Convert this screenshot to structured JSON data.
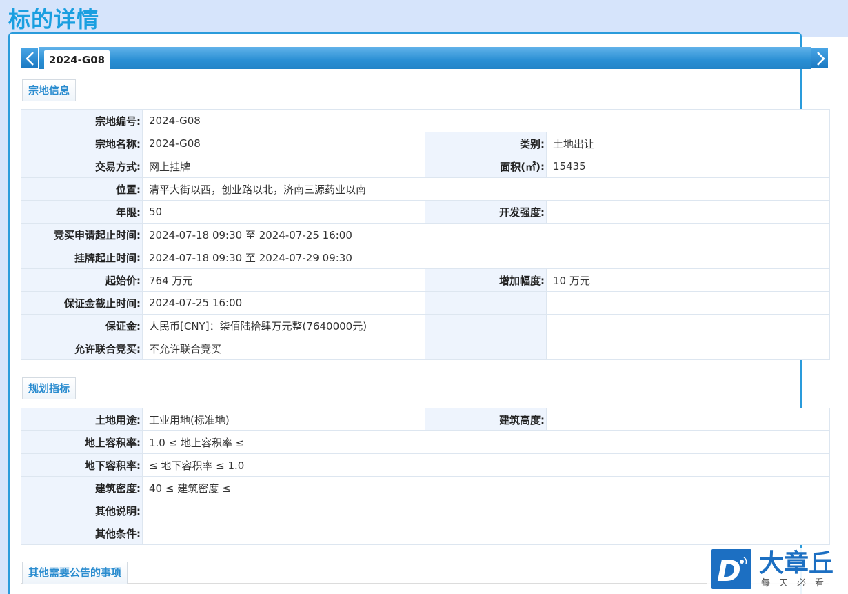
{
  "page": {
    "title": "标的详情"
  },
  "tab": {
    "active_label": "2024-G08"
  },
  "sections": {
    "land_info": "宗地信息",
    "planning": "规划指标",
    "other_notices": "其他需要公告的事项"
  },
  "land_info": {
    "parcel_number": {
      "label": "宗地编号:",
      "value": "2024-G08"
    },
    "parcel_name": {
      "label": "宗地名称:",
      "value": "2024-G08"
    },
    "category": {
      "label": "类别:",
      "value": "土地出让"
    },
    "trade_method": {
      "label": "交易方式:",
      "value": "网上挂牌"
    },
    "area": {
      "label": "面积(㎡):",
      "value": "15435"
    },
    "location": {
      "label": "位置:",
      "value": "清平大街以西，创业路以北，济南三源药业以南"
    },
    "term": {
      "label": "年限:",
      "value": "50"
    },
    "dev_intensity": {
      "label": "开发强度:",
      "value": ""
    },
    "bid_apply_period": {
      "label": "竞买申请起止时间:",
      "value": "2024-07-18 09:30 至 2024-07-25 16:00"
    },
    "listing_period": {
      "label": "挂牌起止时间:",
      "value": "2024-07-18 09:30 至 2024-07-29 09:30"
    },
    "starting_price": {
      "label": "起始价:",
      "value": "764 万元"
    },
    "increment": {
      "label": "增加幅度:",
      "value": "10 万元"
    },
    "deposit_deadline": {
      "label": "保证金截止时间:",
      "value": "2024-07-25 16:00"
    },
    "deposit": {
      "label": "保证金:",
      "value": "人民币[CNY]：柒佰陆拾肆万元整(7640000元)"
    },
    "joint_bid": {
      "label": "允许联合竞买:",
      "value": "不允许联合竞买"
    }
  },
  "planning": {
    "land_use": {
      "label": "土地用途:",
      "value": "工业用地(标准地)"
    },
    "building_height": {
      "label": "建筑高度:",
      "value": ""
    },
    "far_above": {
      "label": "地上容积率:",
      "value": "1.0 ≤ 地上容积率 ≤"
    },
    "far_below": {
      "label": "地下容积率:",
      "value": "≤ 地下容积率 ≤ 1.0"
    },
    "building_density": {
      "label": "建筑密度:",
      "value": "40 ≤ 建筑密度 ≤"
    },
    "other_notes": {
      "label": "其他说明:",
      "value": ""
    },
    "other_conditions": {
      "label": "其他条件:",
      "value": ""
    }
  },
  "watermark": {
    "name": "大章丘",
    "slogan": "每天必看",
    "logo_letter": "D"
  },
  "colors": {
    "accent": "#1a9fe0",
    "tab_bar": "#2a8fd4",
    "label_bg": "#eef4fd",
    "page_bg": "#d6e4fb"
  },
  "icons": {
    "prev": "chevron-left-icon",
    "next": "chevron-right-icon"
  }
}
